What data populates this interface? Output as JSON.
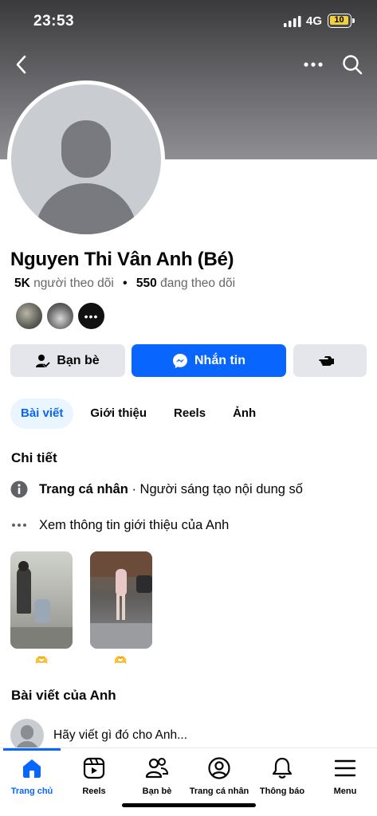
{
  "status_bar": {
    "time": "23:53",
    "network": "4G",
    "battery": "10"
  },
  "profile": {
    "name": "Nguyen Thi Vân Anh (Bé)",
    "followers_count": "5K",
    "followers_label": "người theo dõi",
    "following_count": "550",
    "following_label": "đang theo dõi"
  },
  "actions": {
    "friends": "Bạn bè",
    "message": "Nhắn tin"
  },
  "tabs": [
    {
      "label": "Bài viết"
    },
    {
      "label": "Giới thiệu"
    },
    {
      "label": "Reels"
    },
    {
      "label": "Ảnh"
    }
  ],
  "details": {
    "title": "Chi tiết",
    "page_type_bold": "Trang cá nhân",
    "page_type_rest": " · Người sáng tạo nội dung số",
    "see_more": "Xem thông tin giới thiệu của Anh"
  },
  "photos": {
    "emoji": "🫶"
  },
  "posts": {
    "title": "Bài viết của Anh",
    "composer_placeholder": "Hãy viết gì đó cho Anh..."
  },
  "bottom_nav": [
    {
      "label": "Trang chủ",
      "icon": "home-icon",
      "active": true
    },
    {
      "label": "Reels",
      "icon": "reels-icon"
    },
    {
      "label": "Bạn bè",
      "icon": "friends-icon"
    },
    {
      "label": "Trang cá nhân",
      "icon": "profile-icon"
    },
    {
      "label": "Thông báo",
      "icon": "bell-icon"
    },
    {
      "label": "Menu",
      "icon": "menu-icon"
    }
  ],
  "colors": {
    "accent": "#0866ff",
    "button_gray": "#e4e6eb",
    "secondary_text": "#65676b"
  }
}
